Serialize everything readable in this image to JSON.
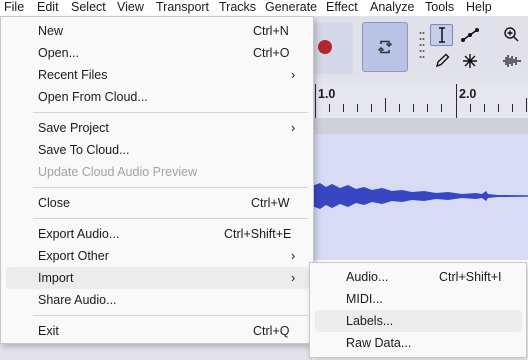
{
  "menubar": {
    "items": [
      "File",
      "Edit",
      "Select",
      "View",
      "Transport",
      "Tracks",
      "Generate",
      "Effect",
      "Analyze",
      "Tools",
      "Help"
    ]
  },
  "ruler": {
    "labels": [
      "1.0",
      "2.0"
    ]
  },
  "file_menu": {
    "items": [
      {
        "label": "New",
        "shortcut": "Ctrl+N"
      },
      {
        "label": "Open...",
        "shortcut": "Ctrl+O"
      },
      {
        "label": "Recent Files",
        "submenu": true
      },
      {
        "label": "Open From Cloud..."
      },
      {
        "label": "Save Project",
        "submenu": true
      },
      {
        "label": "Save To Cloud..."
      },
      {
        "label": "Update Cloud Audio Preview",
        "disabled": true
      },
      {
        "label": "Close",
        "shortcut": "Ctrl+W"
      },
      {
        "label": "Export Audio...",
        "shortcut": "Ctrl+Shift+E"
      },
      {
        "label": "Export Other",
        "submenu": true
      },
      {
        "label": "Import",
        "submenu": true,
        "highlighted": true
      },
      {
        "label": "Share Audio..."
      },
      {
        "label": "Exit",
        "shortcut": "Ctrl+Q"
      }
    ],
    "arrow": "›"
  },
  "import_menu": {
    "items": [
      {
        "label": "Audio...",
        "shortcut": "Ctrl+Shift+I"
      },
      {
        "label": "MIDI..."
      },
      {
        "label": "Labels...",
        "highlighted": true
      },
      {
        "label": "Raw Data..."
      }
    ]
  },
  "icons": {
    "record": "record-icon",
    "loop": "loop-icon",
    "tools": [
      "selection-tool-icon",
      "envelope-tool-icon",
      "draw-tool-icon",
      "multi-tool-icon",
      "zoom-in-icon",
      "audio-waveform-icon"
    ]
  },
  "colors": {
    "record": "#b3272c",
    "waveform": "#3747c4",
    "track_background": "#d8dbf4",
    "menu_highlight": "#ececec"
  }
}
